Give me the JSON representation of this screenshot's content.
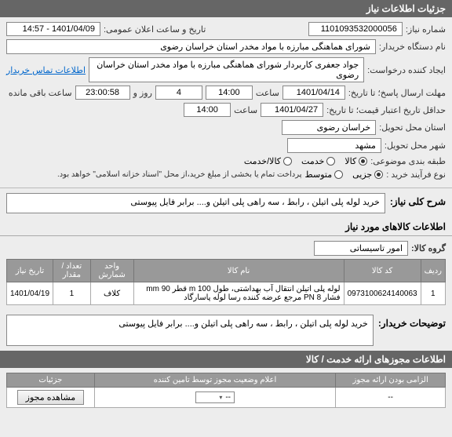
{
  "section1": {
    "title": "جزئیات اطلاعات نیاز"
  },
  "info": {
    "req_no_label": "شماره نیاز:",
    "req_no": "1101093532000056",
    "public_date_label": "تاریخ و ساعت اعلان عمومی:",
    "public_date": "1401/04/09 - 14:57",
    "buyer_label": "نام دستگاه خریدار:",
    "buyer": "شورای هماهنگی مبارزه با مواد مخدر استان خراسان رضوی",
    "creator_label": "ایجاد کننده درخواست:",
    "creator": "جواد جعفری کاربردار شورای هماهنگی مبارزه با مواد مخدر استان خراسان رضوی",
    "contact_link": "اطلاعات تماس خریدار",
    "deadline_label": "مهلت ارسال پاسخ؛ تا تاریخ:",
    "deadline_date": "1401/04/14",
    "time_label": "ساعت",
    "deadline_time": "14:00",
    "days": "4",
    "days_label": "روز و",
    "remaining": "23:00:58",
    "remaining_label": "ساعت باقی مانده",
    "min_valid_label": "حداقل تاریخ اعتبار قیمت؛ تا تاریخ:",
    "min_valid_date": "1401/04/27",
    "min_valid_time": "14:00",
    "province_label": "استان محل تحویل:",
    "province": "خراسان رضوی",
    "city_label": "شهر محل تحویل:",
    "city": "مشهد",
    "category_label": "طبقه بندی موضوعی:",
    "cat_kala": "کالا",
    "cat_khedmat": "خدمت",
    "cat_kalakhedmat": "کالا/خدمت",
    "buy_type_label": "نوع فرآیند خرید :",
    "buy_type_minor": "جزیی",
    "buy_type_mid": "متوسط",
    "buy_note": "پرداخت تمام یا بخشی از مبلغ خرید،از محل \"اسناد خزانه اسلامی\" خواهد بود."
  },
  "desc": {
    "label": "شرح کلی نیاز:",
    "text": "خرید لوله پلی اتیلن ، رابط ، سه راهی پلی اتیلن و....   برابر فایل پیوستی"
  },
  "goods": {
    "header": "اطلاعات کالاهای مورد نیاز",
    "group_label": "گروه کالا:",
    "group": "امور تاسیساتی",
    "cols": {
      "row": "ردیف",
      "code": "کد کالا",
      "name": "نام کالا",
      "unit": "واحد شمارش",
      "qty": "تعداد / مقدار",
      "date": "تاریخ نیاز"
    },
    "rows": [
      {
        "idx": "1",
        "code": "0973100624140063",
        "name": "لوله پلی اتیلن انتقال آب بهداشتی، طول m 100 قطر mm 90 فشار PN 8 مرجع عرضه کننده رسا لوله پاسارگاد",
        "unit": "کلاف",
        "qty": "1",
        "date": "1401/04/19"
      }
    ]
  },
  "buyer_notes": {
    "label": "توضیحات خریدار:",
    "text": "خرید لوله پلی اتیلن ، رابط ، سه راهی پلی اتیلن و....   برابر فایل پیوستی"
  },
  "auth": {
    "header": "اطلاعات مجوزهای ارائه خدمت / کالا",
    "cols": {
      "mandatory": "الزامی بودن ارائه مجوز",
      "declare": "اعلام وضعیت مجوز توسط تامین کننده",
      "details": "جزئیات"
    },
    "dash": "--",
    "view_btn": "مشاهده مجوز"
  }
}
